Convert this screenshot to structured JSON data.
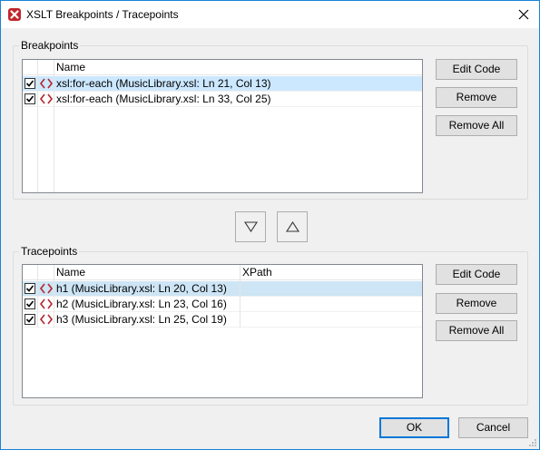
{
  "window": {
    "title": "XSLT Breakpoints / Tracepoints"
  },
  "breakpoints": {
    "group_label": "Breakpoints",
    "columns": [
      "Name"
    ],
    "rows": [
      {
        "checked": true,
        "name": "xsl:for-each  (MusicLibrary.xsl: Ln 21, Col 13)",
        "selected": true
      },
      {
        "checked": true,
        "name": "xsl:for-each  (MusicLibrary.xsl: Ln 33, Col 25)",
        "selected": false
      }
    ],
    "buttons": {
      "edit": "Edit Code",
      "remove": "Remove",
      "remove_all": "Remove All"
    }
  },
  "move": {
    "down_icon": "triangle-down-icon",
    "up_icon": "triangle-up-icon"
  },
  "tracepoints": {
    "group_label": "Tracepoints",
    "columns": [
      "Name",
      "XPath"
    ],
    "rows": [
      {
        "checked": true,
        "name": "h1  (MusicLibrary.xsl: Ln 20, Col 13)",
        "xpath": "",
        "selected": true
      },
      {
        "checked": true,
        "name": "h2  (MusicLibrary.xsl: Ln 23, Col 16)",
        "xpath": "",
        "selected": false
      },
      {
        "checked": true,
        "name": "h3  (MusicLibrary.xsl: Ln 25, Col 19)",
        "xpath": "",
        "selected": false
      }
    ],
    "buttons": {
      "edit": "Edit Code",
      "remove": "Remove",
      "remove_all": "Remove All"
    }
  },
  "footer": {
    "ok": "OK",
    "cancel": "Cancel"
  },
  "colors": {
    "accent": "#0078d7",
    "selection": "#cce8ff",
    "icon_red": "#c0272d"
  }
}
